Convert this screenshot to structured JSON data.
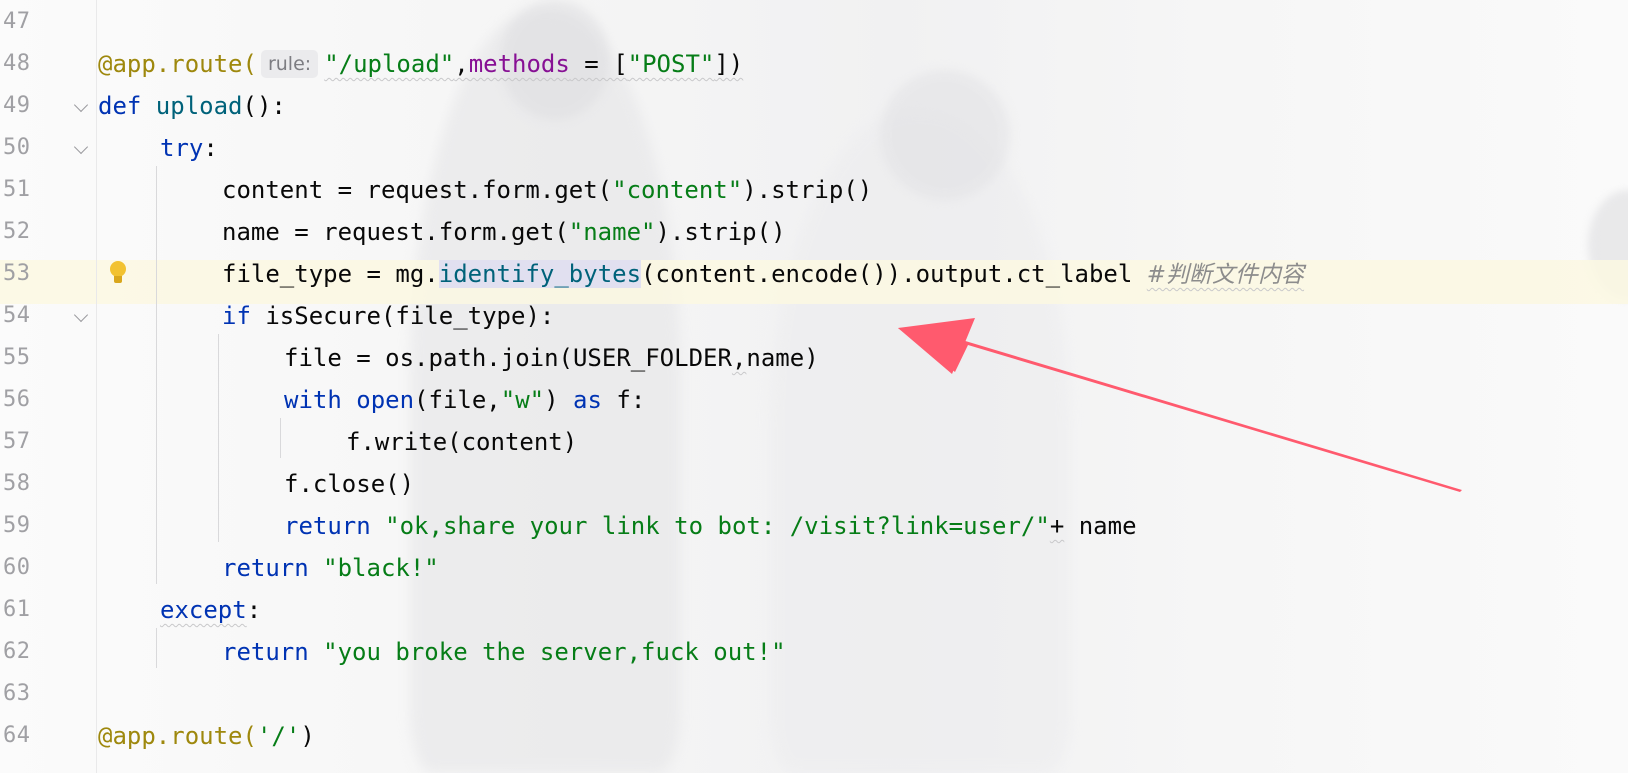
{
  "editor": {
    "accent_colors": {
      "keyword": "#0033b3",
      "string": "#067d17",
      "decorator": "#9e880d",
      "parameter": "#871094",
      "function": "#00627a",
      "comment": "#8c8c8c",
      "arrow": "#ff5a6e"
    },
    "current_line_number": "53",
    "lines": [
      {
        "num": "47"
      },
      {
        "num": "48",
        "deco": "@app.route(",
        "hint": "rule:",
        "route_path": "\"/upload\"",
        "comma": ",",
        "param": "methods",
        "eq": " = [",
        "method": "\"POST\"",
        "close": "])"
      },
      {
        "num": "49",
        "kw": "def ",
        "fn": "upload",
        "rest": "():"
      },
      {
        "num": "50",
        "kw": "try",
        "rest": ":"
      },
      {
        "num": "51",
        "pre": "content = request.form.get(",
        "str": "\"content\"",
        "post": ").strip()"
      },
      {
        "num": "52",
        "pre": "name = request.form.get(",
        "str": "\"name\"",
        "post": ").strip()"
      },
      {
        "num": "53",
        "pre": "file_type = mg.",
        "hl": "identify_bytes",
        "post": "(content.encode()).output.ct_label ",
        "comment": "#判断文件内容"
      },
      {
        "num": "54",
        "kw": "if ",
        "rest": "isSecure(file_type):"
      },
      {
        "num": "55",
        "pre": "file = os.path.join(USER_FOLDER",
        "comma": ",",
        "post": "name)"
      },
      {
        "num": "56",
        "kw": "with ",
        "fn": "open",
        "pre": "(file,",
        "str": "\"w\"",
        "post": ") ",
        "kw2": "as",
        "post2": " f:"
      },
      {
        "num": "57",
        "pre": "f.write(content)"
      },
      {
        "num": "58",
        "pre": "f.close()"
      },
      {
        "num": "59",
        "kw": "return ",
        "str": "\"ok,share your link to bot: /visit?link=user/\"",
        "plus": "+",
        "post": " name"
      },
      {
        "num": "60",
        "kw": "return ",
        "str": "\"black!\""
      },
      {
        "num": "61",
        "kw": "except",
        "rest": ":"
      },
      {
        "num": "62",
        "kw": "return ",
        "str": "\"you broke the server,fuck out!\""
      },
      {
        "num": "63"
      },
      {
        "num": "64",
        "deco": "@app.route(",
        "str": "'/'",
        "close": ")"
      }
    ]
  }
}
